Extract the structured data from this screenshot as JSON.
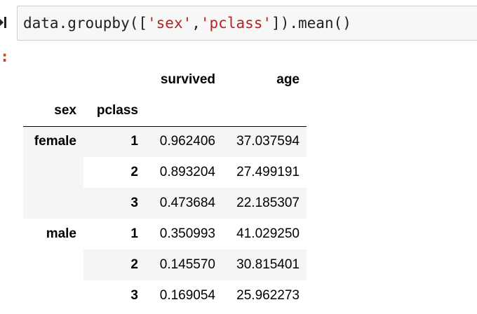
{
  "cell": {
    "code_prefix": "data.groupby([",
    "code_str1": "'sex'",
    "code_comma": ",",
    "code_str2": "'pclass'",
    "code_suffix": "]).mean()",
    "output_prompt": ":"
  },
  "table": {
    "columns": [
      "survived",
      "age"
    ],
    "index_names": [
      "sex",
      "pclass"
    ],
    "rows": [
      {
        "sex": "female",
        "pclass": "1",
        "survived": "0.962406",
        "age": "37.037594"
      },
      {
        "sex": "",
        "pclass": "2",
        "survived": "0.893204",
        "age": "27.499191"
      },
      {
        "sex": "",
        "pclass": "3",
        "survived": "0.473684",
        "age": "22.185307"
      },
      {
        "sex": "male",
        "pclass": "1",
        "survived": "0.350993",
        "age": "41.029250"
      },
      {
        "sex": "",
        "pclass": "2",
        "survived": "0.145570",
        "age": "30.815401"
      },
      {
        "sex": "",
        "pclass": "3",
        "survived": "0.169054",
        "age": "25.962273"
      }
    ]
  },
  "colors": {
    "string": "#ba2121",
    "prompt": "#d84315",
    "stripe": "#f5f5f5"
  }
}
